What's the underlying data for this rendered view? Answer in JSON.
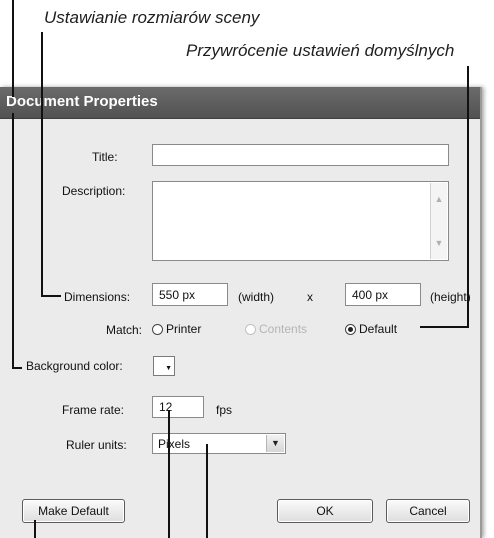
{
  "captions": {
    "scene_size": "Ustawianie rozmiarów sceny",
    "restore_defaults": "Przywrócenie ustawień domyślnych"
  },
  "dialog": {
    "title": "Document Properties",
    "title_label": "Title:",
    "title_value": "",
    "description_label": "Description:",
    "description_value": "",
    "dimensions_label": "Dimensions:",
    "width_value": "550 px",
    "width_unit": "(width)",
    "times": "x",
    "height_value": "400 px",
    "height_unit": "(height)",
    "match_label": "Match:",
    "match_options": [
      "Printer",
      "Contents",
      "Default"
    ],
    "match_selected": "Default",
    "match_disabled": [
      "Contents"
    ],
    "background_label": "Background color:",
    "background_color": "#ffffff",
    "frame_rate_label": "Frame rate:",
    "frame_rate_value": "12",
    "frame_rate_unit": "fps",
    "ruler_label": "Ruler units:",
    "ruler_value": "Pixels",
    "make_default_label": "Make Default",
    "ok_label": "OK",
    "cancel_label": "Cancel"
  },
  "icons": {
    "scroll_up": "chevron-up-icon",
    "scroll_down": "chevron-down-icon",
    "select_arrow": "chevron-down-icon",
    "swatch_arrow": "triangle-down-icon"
  },
  "colors": {
    "titlebar": "#5a5a5a",
    "dialog_bg": "#ebebeb"
  }
}
